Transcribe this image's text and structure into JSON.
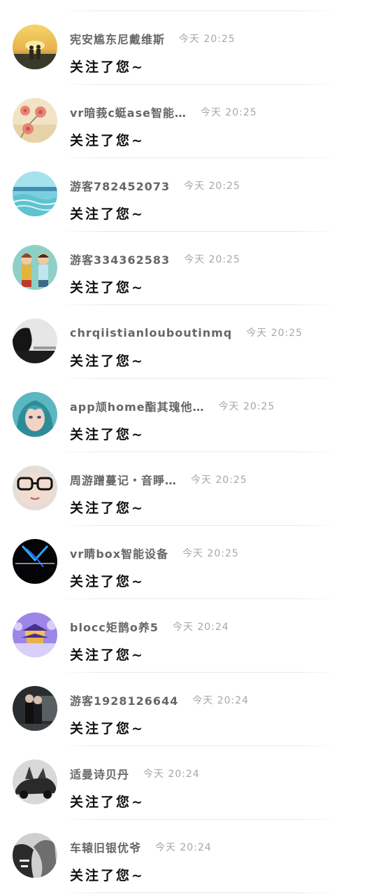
{
  "notifications": [
    {
      "name": "宪安尴东尼戴维斯",
      "time": "今天 20:25",
      "message": "关注了您~",
      "avatar": "sunset-couple"
    },
    {
      "name": "vr暗莪c蜓ase智能…",
      "time": "今天 20:25",
      "message": "关注了您~",
      "avatar": "pink-flowers"
    },
    {
      "name": "游客782452073",
      "time": "今天 20:25",
      "message": "关注了您~",
      "avatar": "ocean-wave"
    },
    {
      "name": "游客334362583",
      "time": "今天 20:25",
      "message": "关注了您~",
      "avatar": "cartoon-couple"
    },
    {
      "name": "chrqiistianlouboutinmq",
      "time": "今天 20:25",
      "message": "关注了您~",
      "avatar": "black-white-portrait"
    },
    {
      "name": "app颃home酯其瑰他…",
      "time": "今天 20:25",
      "message": "关注了您~",
      "avatar": "anime-girl"
    },
    {
      "name": "周游蹭蔓记・音睜…",
      "time": "今天 20:25",
      "message": "关注了您~",
      "avatar": "glasses-face"
    },
    {
      "name": "vr睛box智能设备",
      "time": "今天 20:25",
      "message": "关注了您~",
      "avatar": "neon-logo"
    },
    {
      "name": "blocc矩鹊o养5",
      "time": "今天 20:24",
      "message": "关注了您~",
      "avatar": "purple-temple"
    },
    {
      "name": "游客1928126644",
      "time": "今天 20:24",
      "message": "关注了您~",
      "avatar": "night-couple"
    },
    {
      "name": "适曼诗贝丹",
      "time": "今天 20:24",
      "message": "关注了您~",
      "avatar": "supercar"
    },
    {
      "name": "车辕旧银优爷",
      "time": "今天 20:24",
      "message": "关注了您~",
      "avatar": "mono-sketch"
    }
  ]
}
